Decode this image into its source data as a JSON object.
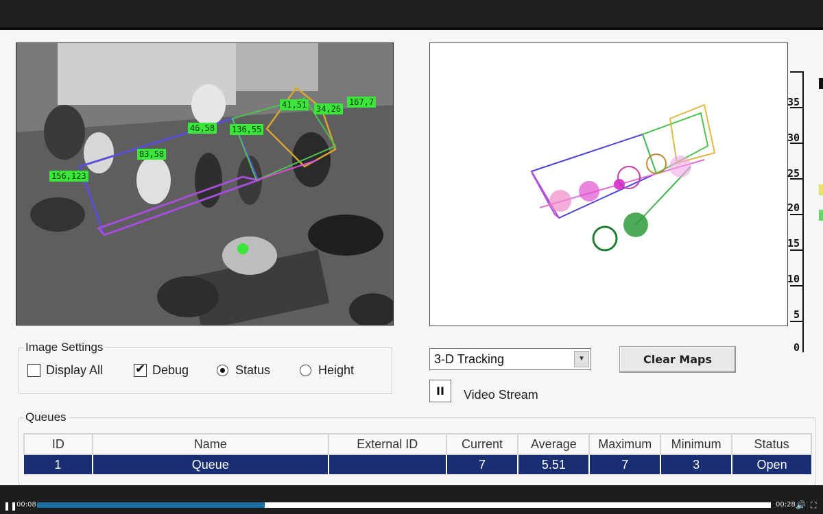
{
  "camera": {
    "tracks": [
      "156,123",
      "83,58",
      "46,58",
      "136,55",
      "41,51",
      "34,26",
      "167,7"
    ]
  },
  "map": {
    "scale_labels": [
      "35",
      "30",
      "25",
      "20",
      "15",
      "10",
      "5",
      "0"
    ]
  },
  "image_settings": {
    "title": "Image Settings",
    "display_all": {
      "label": "Display All",
      "checked": false
    },
    "debug": {
      "label": "Debug",
      "checked": true
    },
    "status": {
      "label": "Status",
      "selected": true
    },
    "height": {
      "label": "Height",
      "selected": false
    }
  },
  "controls": {
    "mode_select": "3-D Tracking",
    "clear_maps": "Clear Maps",
    "pause_glyph": "II",
    "video_stream": "Video Stream"
  },
  "queues": {
    "title": "Queues",
    "columns": [
      "ID",
      "Name",
      "External ID",
      "Current",
      "Average",
      "Maximum",
      "Minimum",
      "Status"
    ],
    "rows": [
      [
        "1",
        "Queue",
        "",
        "7",
        "5.51",
        "7",
        "3",
        "Open"
      ]
    ]
  },
  "player": {
    "elapsed": "00:08",
    "duration": "00:28",
    "progress": 0.31,
    "progress_color": "#1b6f9e"
  }
}
